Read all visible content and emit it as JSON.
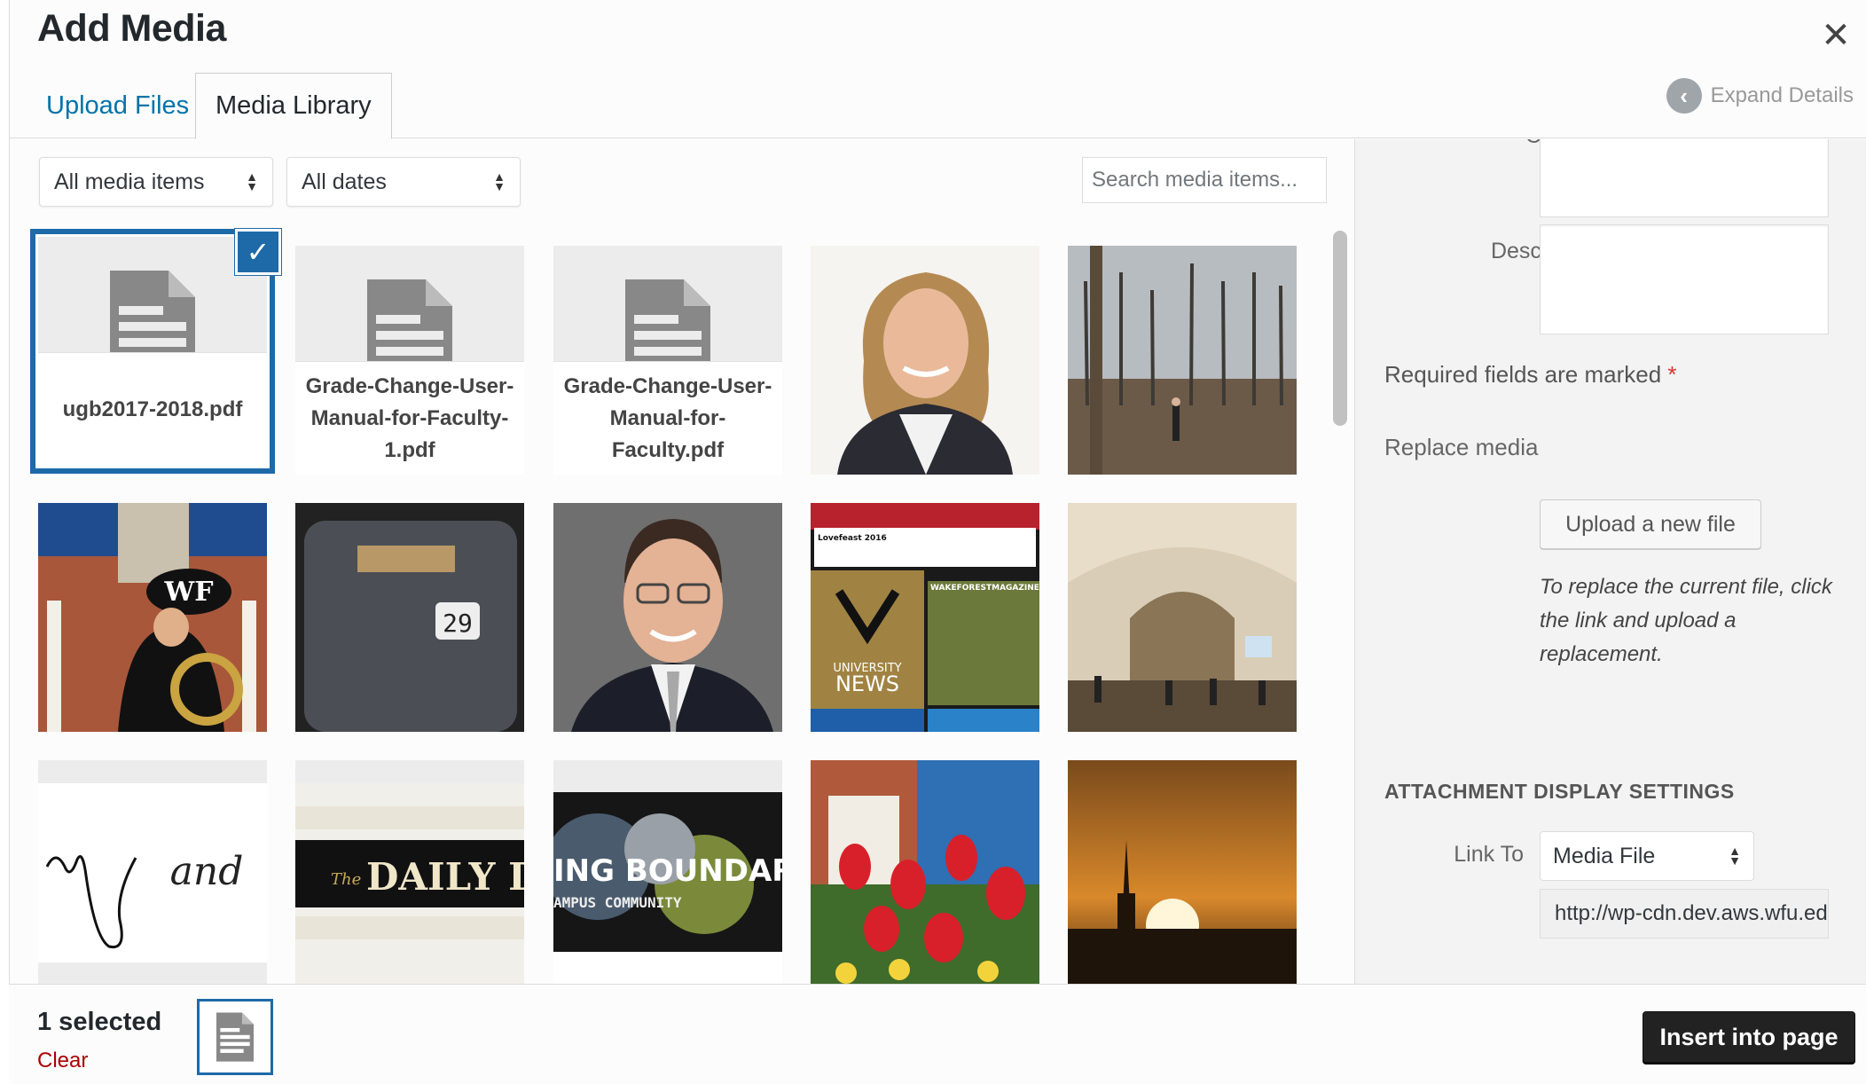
{
  "modal": {
    "title": "Add Media",
    "close_icon": "close-icon",
    "tabs": [
      {
        "label": "Upload Files",
        "active": false
      },
      {
        "label": "Media Library",
        "active": true
      }
    ],
    "expand_details": "Expand Details"
  },
  "toolbar": {
    "type_filter": "All media items",
    "date_filter": "All dates",
    "search_placeholder": "Search media items..."
  },
  "media": {
    "doc1": "ugb2017-2018.pdf",
    "doc2": "Grade-Change-User-Manual-for-Faculty-1.pdf",
    "doc3": "Grade-Change-User-Manual-for-Faculty.pdf",
    "daily_text": "DAILY D",
    "daily_prefix": "The",
    "boundaries_text": "ING BOUNDARIES:",
    "campus_text": "AMPUS COMMUNITY",
    "news_small": "UNIVERSITY",
    "news_big": "NEWS",
    "news_header": "Lovefeast 2016",
    "magazine": "WAKEFORESTMAGAZINE",
    "chair_number": "29",
    "wf_logo": "WF",
    "signature": "and"
  },
  "details": {
    "caption_label": "Caption",
    "description_label": "Description",
    "required_text": "Required fields are marked",
    "required_star": "*",
    "replace_label": "Replace media",
    "upload_button": "Upload a new file",
    "replace_note": "To replace the current file, click the link and upload a replacement.",
    "display_heading": "Attachment Display Settings",
    "link_to_label": "Link To",
    "link_to_value": "Media File",
    "url_value": "http://wp-cdn.dev.aws.wfu.edu/"
  },
  "footer": {
    "selected_count": "1 selected",
    "clear": "Clear",
    "insert_button": "Insert into page"
  },
  "colors": {
    "accent": "#1e6aa8",
    "link": "#0073aa",
    "danger": "#a00",
    "primary_button": "#222222"
  }
}
